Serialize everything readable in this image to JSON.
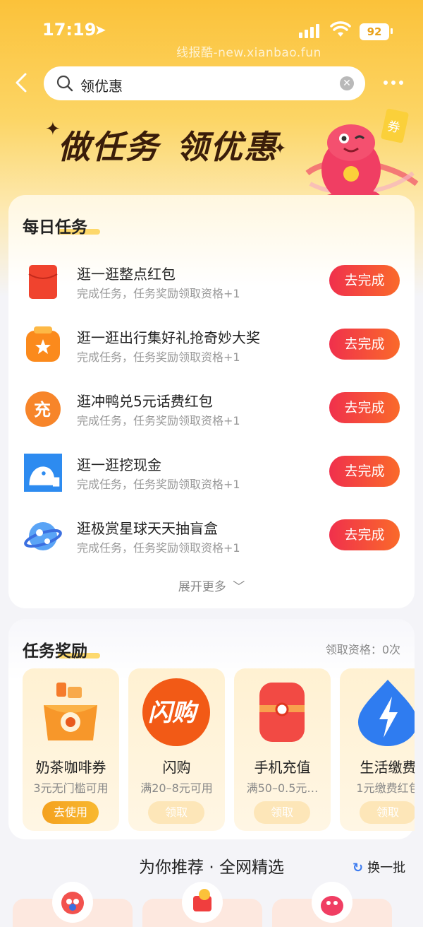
{
  "status": {
    "time": "17:19",
    "battery": "92"
  },
  "watermark": "线报酷-new.xianbao.fun",
  "search": {
    "text": "领优惠"
  },
  "banner": {
    "title_part1": "做任务",
    "title_part2": "领优惠",
    "mascot_tag": "券"
  },
  "daily_tasks": {
    "title": "每日任务",
    "items": [
      {
        "title": "逛一逛整点红包",
        "subtitle": "完成任务，任务奖励领取资格+1",
        "button": "去完成",
        "icon": "red-envelope-icon"
      },
      {
        "title": "逛一逛出行集好礼抢奇妙大奖",
        "subtitle": "完成任务，任务奖励领取资格+1",
        "button": "去完成",
        "icon": "gift-box-icon"
      },
      {
        "title": "逛冲鸭兑5元话费红包",
        "subtitle": "完成任务，任务奖励领取资格+1",
        "button": "去完成",
        "icon": "recharge-icon",
        "icon_text": "充"
      },
      {
        "title": "逛一逛挖现金",
        "subtitle": "完成任务，任务奖励领取资格+1",
        "button": "去完成",
        "icon": "dig-cash-icon"
      },
      {
        "title": "逛极赏星球天天抽盲盒",
        "subtitle": "完成任务，任务奖励领取资格+1",
        "button": "去完成",
        "icon": "planet-icon"
      }
    ],
    "expand": "展开更多"
  },
  "rewards": {
    "title": "任务奖励",
    "eligibility": "领取资格：0次",
    "items": [
      {
        "name": "奶茶咖啡券",
        "desc": "3元无门槛可用",
        "button": "去使用",
        "icon": "coffee-coupon-icon"
      },
      {
        "name": "闪购",
        "desc": "满20–8元可用",
        "button": "领取",
        "icon": "flash-buy-icon",
        "icon_text": "闪购"
      },
      {
        "name": "手机充值",
        "desc": "满50–0.5元…",
        "button": "领取",
        "icon": "phone-recharge-icon"
      },
      {
        "name": "生活缴费",
        "desc": "1元缴费红包",
        "button": "领取",
        "icon": "utility-bill-icon"
      }
    ]
  },
  "recommend": {
    "title": "为你推荐 · 全网精选",
    "refresh": "换一批"
  },
  "colors": {
    "accent": "#f0304c",
    "gold": "#fbc23a",
    "reward_btn": "#f4a11f"
  }
}
